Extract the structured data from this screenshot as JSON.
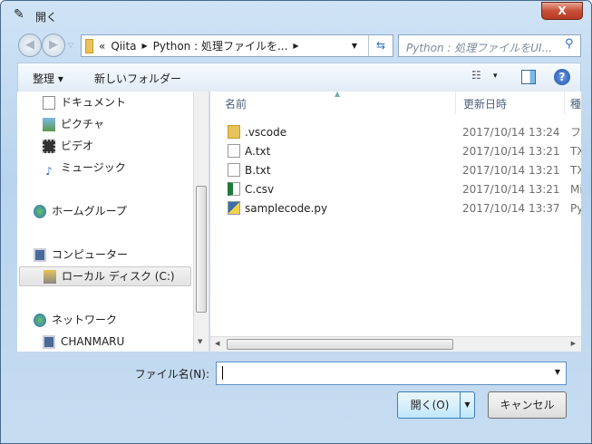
{
  "window": {
    "title": "開く",
    "close_label": "X"
  },
  "nav": {
    "breadcrumb": [
      "«",
      "Qiita",
      "Python : 処理ファイルを..."
    ],
    "search_placeholder": "Python : 処理ファイルをUI..."
  },
  "toolbar": {
    "organize": "整理 ▾",
    "new_folder": "新しいフォルダー",
    "view": "▾"
  },
  "sidebar": {
    "items": [
      "ドキュメント",
      "ピクチャ",
      "ビデオ",
      "ミュージック",
      "ホームグループ",
      "コンピューター",
      "ローカル ディスク (C:)",
      "ネットワーク",
      "CHANMARU"
    ]
  },
  "files": {
    "columns": [
      "名前",
      "更新日時",
      "種"
    ],
    "rows": [
      {
        "name": ".vscode",
        "date": "2017/10/14 13:24",
        "type": "フ",
        "icon": "folder-icon"
      },
      {
        "name": "A.txt",
        "date": "2017/10/14 13:21",
        "type": "TX",
        "icon": "text-file-icon"
      },
      {
        "name": "B.txt",
        "date": "2017/10/14 13:21",
        "type": "TX",
        "icon": "text-file-icon"
      },
      {
        "name": "C.csv",
        "date": "2017/10/14 13:21",
        "type": "Mi",
        "icon": "excel-file-icon"
      },
      {
        "name": "samplecode.py",
        "date": "2017/10/14 13:37",
        "type": "Py",
        "icon": "python-file-icon"
      }
    ]
  },
  "footer": {
    "filename_label": "ファイル名(N):",
    "filename_value": "",
    "open_label": "開く(O)",
    "cancel_label": "キャンセル"
  }
}
